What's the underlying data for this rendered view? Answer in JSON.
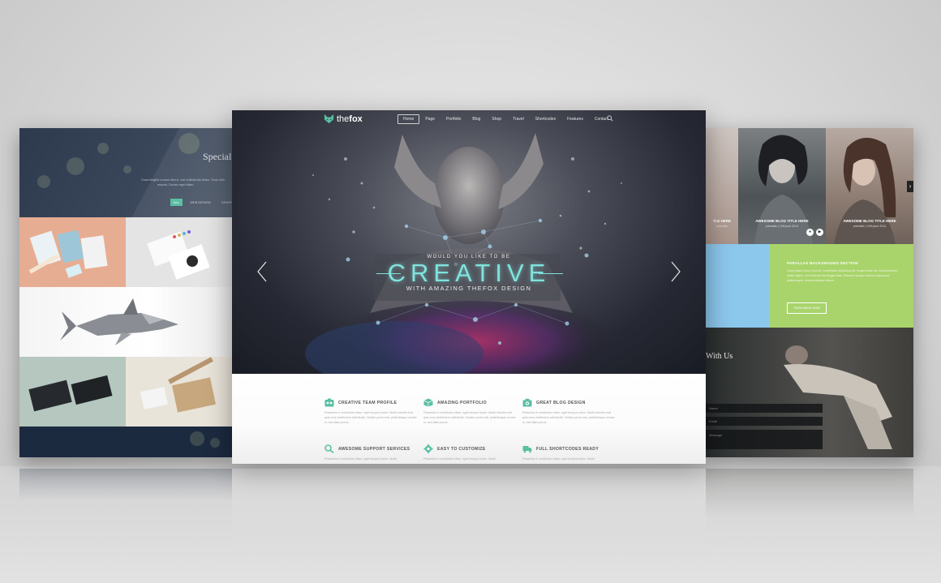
{
  "left_panel": {
    "title": "Special Po",
    "subtitle_line1": "Cras fringilla cursus libero, nisi sollicitudin tellus. Duis nibh",
    "subtitle_line2": "mauris. Donec eget diam",
    "filters": [
      {
        "label": "ALL",
        "active": true
      },
      {
        "label": "WEB DESIGN",
        "active": false
      },
      {
        "label": "GRAPHIC D",
        "active": false
      }
    ]
  },
  "center_panel": {
    "logo_prefix": "the",
    "logo_bold": "fox",
    "nav": [
      {
        "label": "Home",
        "active": true
      },
      {
        "label": "Page",
        "active": false
      },
      {
        "label": "Portfolio",
        "active": false
      },
      {
        "label": "Blog",
        "active": false
      },
      {
        "label": "Shop",
        "active": false
      },
      {
        "label": "Travel",
        "active": false
      },
      {
        "label": "Shortcodes",
        "active": false
      },
      {
        "label": "Features",
        "active": false
      },
      {
        "label": "Contact",
        "active": false
      }
    ],
    "slider": {
      "top_text": "WOULD YOU LIKE TO BE",
      "main_text": "CREATIVE",
      "bottom_text": "WITH AMAZING THEFOX DESIGN"
    },
    "features": [
      {
        "icon": "team-icon",
        "title": "CREATIVE TEAM PROFILE",
        "text": "Phasellus in vestibulum diam, eget tempus lorem. Morbi lobortis erat quis eros vestibulum sollicitudin. Nullam porta erat, pellentesque ornare in, sed diam purus."
      },
      {
        "icon": "cube-icon",
        "title": "AMAZING PORTFOLIO",
        "text": "Phasellus in vestibulum diam, eget tempus lorem. Morbi lobortis erat quis eros vestibulum sollicitudin. Nullam porta erat, pellentesque ornare in, sed diam purus."
      },
      {
        "icon": "camera-icon",
        "title": "GREAT BLOG DESIGN",
        "text": "Phasellus in vestibulum diam, eget tempus lorem. Morbi lobortis erat quis eros vestibulum sollicitudin. Nullam porta erat, pellentesque ornare in, sed diam purus."
      },
      {
        "icon": "search-icon",
        "title": "AWESOME SUPPORT SERVICES",
        "text": "Phasellus in vestibulum diam, eget tempus lorem. Morbi"
      },
      {
        "icon": "gear-icon",
        "title": "EASY TO CUSTOMIZE",
        "text": "Phasellus in vestibulum diam, eget tempus lorem. Morbi"
      },
      {
        "icon": "truck-icon",
        "title": "FULL SHORTCODES READY",
        "text": "Phasellus in vestibulum diam, eget tempus lorem. Morbi"
      }
    ]
  },
  "right_panel": {
    "blog_items": [
      {
        "title": "TLE HERE",
        "meta": "prismatic"
      },
      {
        "title": "AWESOME BLOG TITLE HERE",
        "meta": "prismatic | 10th june 2014"
      },
      {
        "title": "AWESOME BLOG TITLE HERE",
        "meta": "prismatic | 10th june 2014"
      }
    ],
    "parallax_title": "PARALLAX BACKGROUND SECTION",
    "parallax_text": "Lorem ipsum dolor sit amet, consectetur adipiscing elit. Suspendisse dui. Morbi interdum mollis sapien, sed vehicula nisl feugiat vitae. Praesent congue ultrices massa sed pellentesque. Aenean tristique dictum",
    "purchase_label": "PURCHASE NOW",
    "contact_title": "With Us",
    "contact_fields": [
      "Name",
      "Email",
      "Message"
    ]
  },
  "colors": {
    "accent": "#5bbfa4",
    "creative": "#7fe3dd",
    "parallax_green": "#a9d46c",
    "sky_blue": "#8cc8ec"
  }
}
